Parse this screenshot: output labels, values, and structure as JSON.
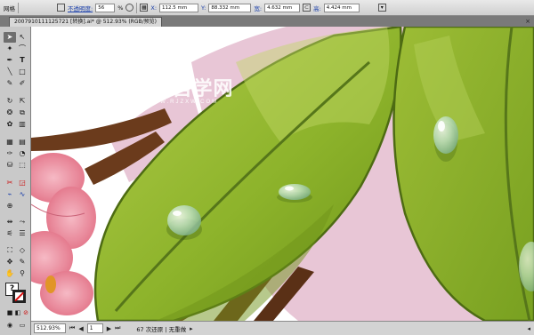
{
  "control_bar": {
    "panel_label": "网格",
    "opacity_label": "不透明度:",
    "opacity_value": "56",
    "opacity_unit": "%",
    "x_label": "X:",
    "x_value": "112.5 mm",
    "y_label": "Y:",
    "y_value": "88.332 mm",
    "w_label": "宽:",
    "w_value": "4.632 mm",
    "h_label": "高:",
    "h_value": "4.424 mm"
  },
  "document_tab": {
    "title": "2007910111125721 [转换].ai* @ 512.93% (RGB/预览)",
    "close": "×"
  },
  "status_bar": {
    "zoom": "512.93%",
    "page": "1",
    "message": "67 次还原 | 无重做"
  },
  "watermark": {
    "main": "软件自学网",
    "sub": "WWW.RJZXW.COM"
  },
  "colors": {
    "leaf_green": "#8bb32a",
    "leaf_dark": "#4d6b13",
    "branch_brown": "#6b3b1c",
    "pink_outline": "#e8c6d6",
    "flower_pink": "#ee8a9e"
  }
}
